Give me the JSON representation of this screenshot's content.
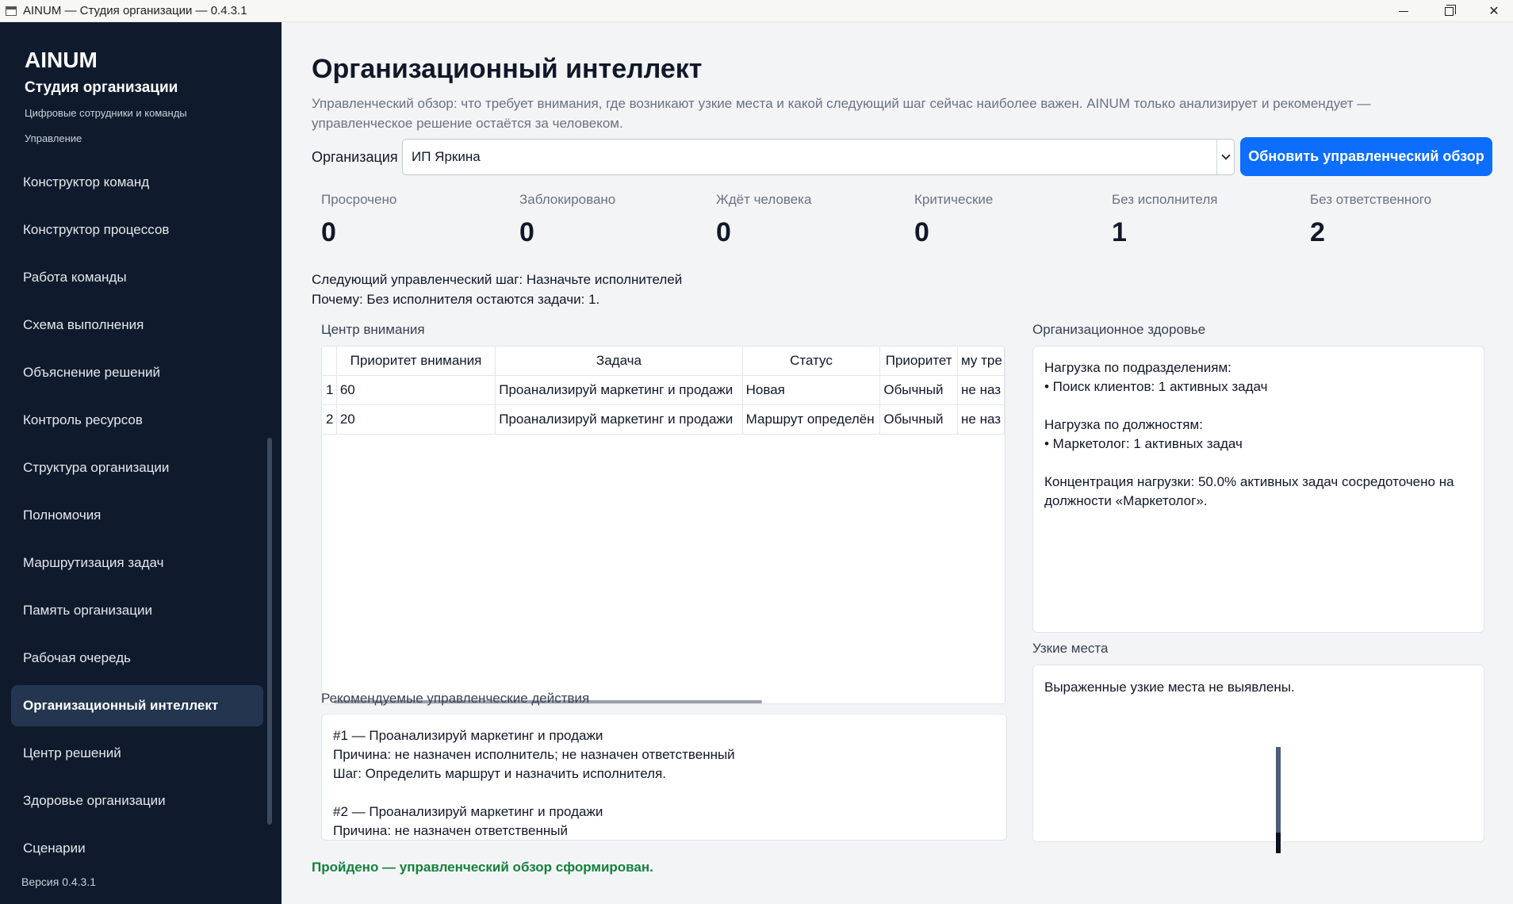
{
  "window": {
    "title": "AINUM — Студия организации — 0.4.3.1"
  },
  "sidebar": {
    "brand": "AINUM",
    "subtitle": "Студия организации",
    "description": "Цифровые сотрудники и команды",
    "section_label": "Управление",
    "items": [
      {
        "label": "Конструктор команд",
        "active": false
      },
      {
        "label": "Конструктор процессов",
        "active": false
      },
      {
        "label": "Работа команды",
        "active": false
      },
      {
        "label": "Схема выполнения",
        "active": false
      },
      {
        "label": "Объяснение решений",
        "active": false
      },
      {
        "label": "Контроль ресурсов",
        "active": false
      },
      {
        "label": "Структура организации",
        "active": false
      },
      {
        "label": "Полномочия",
        "active": false
      },
      {
        "label": "Маршрутизация задач",
        "active": false
      },
      {
        "label": "Память организации",
        "active": false
      },
      {
        "label": "Рабочая очередь",
        "active": false
      },
      {
        "label": "Организационный интеллект",
        "active": true
      },
      {
        "label": "Центр решений",
        "active": false
      },
      {
        "label": "Здоровье организации",
        "active": false
      },
      {
        "label": "Сценарии",
        "active": false
      }
    ],
    "version": "Версия 0.4.3.1"
  },
  "main": {
    "title": "Организационный интеллект",
    "description": "Управленческий обзор: что требует внимания, где возникают узкие места и какой следующий шаг сейчас наиболее важен. AINUM только анализирует и рекомендует — управленческое решение остаётся за человеком.",
    "org_label": "Организация",
    "org_value": "ИП Яркина",
    "refresh_label": "Обновить управленческий обзор",
    "stats": [
      {
        "label": "Просрочено",
        "value": "0"
      },
      {
        "label": "Заблокировано",
        "value": "0"
      },
      {
        "label": "Ждёт человека",
        "value": "0"
      },
      {
        "label": "Критические",
        "value": "0"
      },
      {
        "label": "Без исполнителя",
        "value": "1"
      },
      {
        "label": "Без ответственного",
        "value": "2"
      }
    ],
    "next_step": "Следующий управленческий шаг: Назначьте исполнителей",
    "next_step_reason": "Почему: Без исполнителя остаются задачи: 1.",
    "attention": {
      "label": "Центр внимания",
      "columns": [
        "",
        "Приоритет внимания",
        "Задача",
        "Статус",
        "Приоритет",
        "му тре"
      ],
      "rows": [
        [
          "1",
          "60",
          "Проанализируй маркетинг и продажи",
          "Новая",
          "Обычный",
          "не наз"
        ],
        [
          "2",
          "20",
          "Проанализируй маркетинг и продажи",
          "Маршрут определён",
          "Обычный",
          "не наз"
        ]
      ]
    },
    "health": {
      "label": "Организационное здоровье",
      "dept_title": "Нагрузка по подразделениям:",
      "dept_line": "• Поиск клиентов: 1 активных задач",
      "role_title": "Нагрузка по должностям:",
      "role_line": "• Маркетолог: 1 активных задач",
      "concentration": "Концентрация нагрузки: 50.0% активных задач сосредоточено на должности «Маркетолог»."
    },
    "bottlenecks": {
      "label": "Узкие места",
      "text": "Выраженные узкие места не выявлены."
    },
    "recommendations": {
      "label": "Рекомендуемые управленческие действия",
      "r1_title": "#1 — Проанализируй маркетинг и продажи",
      "r1_reason": "Причина: не назначен исполнитель; не назначен ответственный",
      "r1_step": "Шаг: Определить маршрут и назначить исполнителя.",
      "r2_title": "#2 — Проанализируй маркетинг и продажи",
      "r2_reason": "Причина: не назначен ответственный"
    },
    "status": "Пройдено — управленческий обзор сформирован."
  },
  "colors": {
    "sidebar_bg": "#0f1b2d",
    "sidebar_active": "#24364f",
    "accent": "#0d6efd",
    "success": "#15803d"
  }
}
